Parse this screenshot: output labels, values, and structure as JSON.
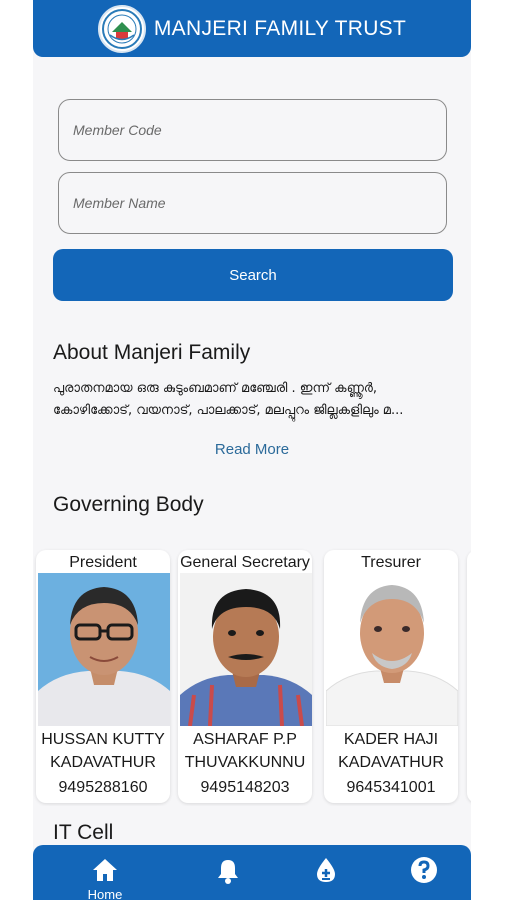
{
  "app": {
    "title": "MANJERI FAMILY TRUST"
  },
  "search": {
    "member_code_placeholder": "Member Code",
    "member_name_placeholder": "Member Name",
    "button_label": "Search"
  },
  "about": {
    "title": "About Manjeri Family",
    "text": "പുരാതനമായ ഒരു കുടുംബമാണ് മഞ്ചേരി . ഇന്ന് കണ്ണൂർ, കോഴിക്കോട്, വയനാട്, പാലക്കാട്, മലപ്പുറം ജില്ലകളിലും മ...",
    "read_more": "Read More"
  },
  "governing_body": {
    "title": "Governing Body",
    "members": [
      {
        "role": "President",
        "name": "HUSSAN KUTTY",
        "place": "KADAVATHUR",
        "phone": "9495288160"
      },
      {
        "role": "General Secretary",
        "name": "ASHARAF P.P",
        "place": "THUVAKKUNNU",
        "phone": "9495148203"
      },
      {
        "role": "Tresurer",
        "name": "KADER HAJI",
        "place": "KADAVATHUR",
        "phone": "9645341001"
      }
    ]
  },
  "it_cell": {
    "title": "IT Cell"
  },
  "nav": {
    "items": [
      {
        "label": "Home",
        "icon": "home-icon"
      },
      {
        "label": "",
        "icon": "bell-icon"
      },
      {
        "label": "",
        "icon": "blood-drop-icon"
      },
      {
        "label": "",
        "icon": "help-icon"
      }
    ]
  },
  "colors": {
    "primary": "#1366b8",
    "link": "#2b6a9a",
    "background": "#f6f6f8"
  }
}
